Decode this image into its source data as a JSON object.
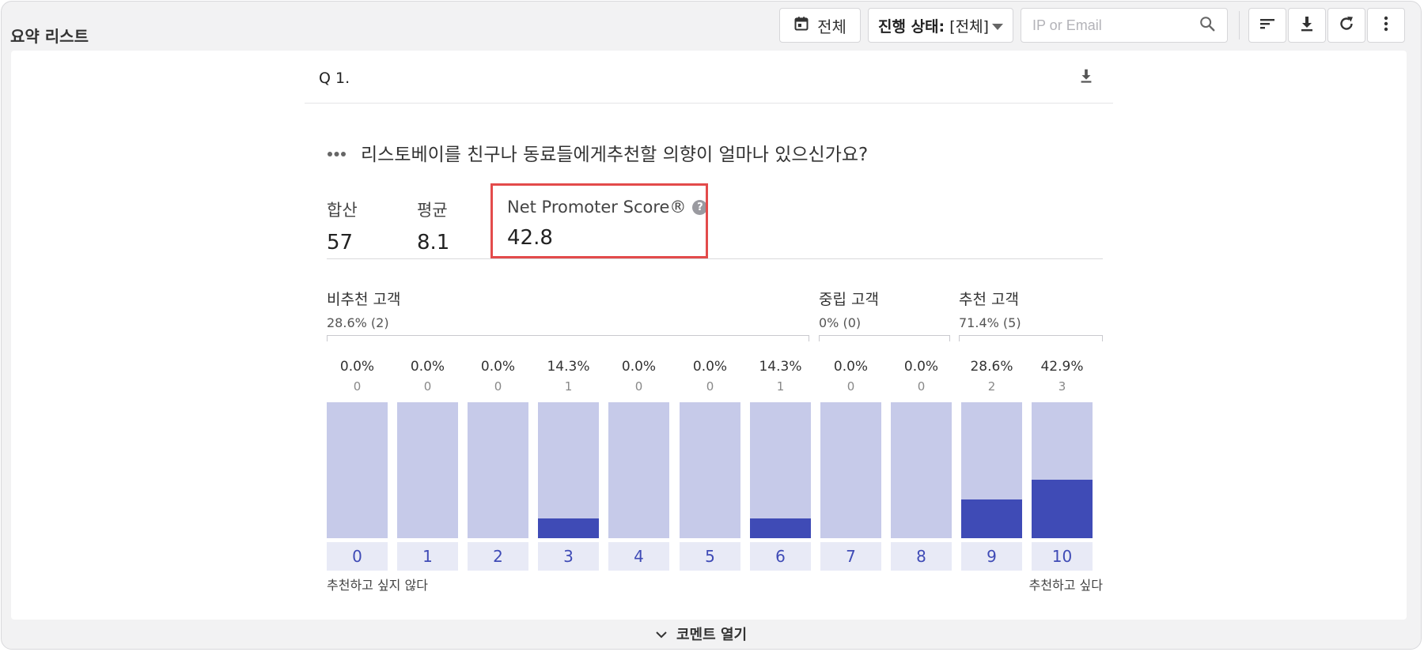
{
  "page": {
    "title": "요약 리스트"
  },
  "toolbar": {
    "date_label": "전체",
    "status_prefix": "진행 상태:",
    "status_value": "[전체]",
    "search_placeholder": "IP or Email",
    "icons": [
      "calendar-icon",
      "chevron-down-icon",
      "search-icon",
      "sort-icon",
      "download-icon",
      "refresh-icon",
      "more-vertical-icon"
    ]
  },
  "question": {
    "number": "Q 1.",
    "text": "리스토베이를 친구나 동료들에게추천할 의향이 얼마나 있으신가요?"
  },
  "stats": {
    "sum_label": "합산",
    "sum_value": "57",
    "avg_label": "평균",
    "avg_value": "8.1",
    "nps_label": "Net Promoter Score®",
    "nps_value": "42.8"
  },
  "groups": {
    "detractors": {
      "name": "비추천 고객",
      "pct": "28.6% (2)"
    },
    "passives": {
      "name": "중립 고객",
      "pct": "0% (0)"
    },
    "promoters": {
      "name": "추천 고객",
      "pct": "71.4% (5)"
    }
  },
  "chart_data": {
    "type": "bar",
    "categories": [
      "0",
      "1",
      "2",
      "3",
      "4",
      "5",
      "6",
      "7",
      "8",
      "9",
      "10"
    ],
    "percent_labels": [
      "0.0%",
      "0.0%",
      "0.0%",
      "14.3%",
      "0.0%",
      "0.0%",
      "14.3%",
      "0.0%",
      "0.0%",
      "28.6%",
      "42.9%"
    ],
    "counts": [
      0,
      0,
      0,
      1,
      0,
      0,
      1,
      0,
      0,
      2,
      3
    ],
    "values": [
      0.0,
      0.0,
      0.0,
      14.3,
      0.0,
      0.0,
      14.3,
      0.0,
      0.0,
      28.6,
      42.9
    ],
    "ylim": [
      0,
      100
    ],
    "colors": {
      "track": "#c6cae9",
      "fill": "#3f4bb6"
    }
  },
  "scale": {
    "low_label": "추천하고 싶지 않다",
    "high_label": "추천하고 싶다"
  },
  "footer": {
    "comment_toggle": "코멘트 열기"
  },
  "colors": {
    "accent": "#3f4bb6",
    "highlight": "#e34b4b"
  }
}
